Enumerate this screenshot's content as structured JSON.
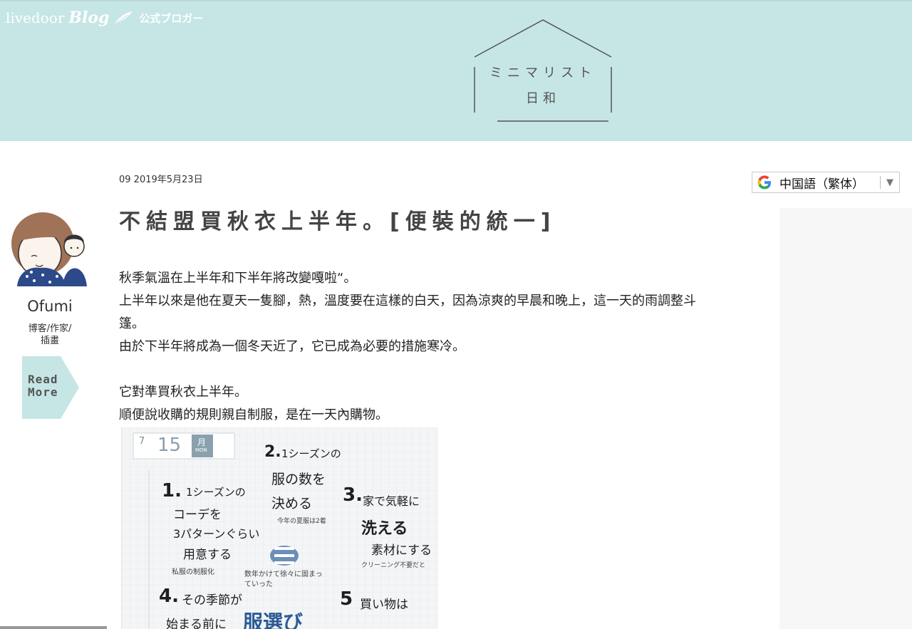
{
  "header": {
    "brand_livedoor": "livedoor",
    "brand_blog": "Blog",
    "brand_official": "公式ブロガー",
    "blog_title": "ミニマリスト",
    "blog_subtitle": "日和",
    "background_color": "#c5e6e4"
  },
  "translate_widget": {
    "language": "中国語（繁体）",
    "icon": "google-g-icon",
    "arrow": "▼"
  },
  "profile": {
    "name": "Ofumi",
    "role_line1": "博客/作家/",
    "role_line2": "插畫",
    "read_more_line1": "Read",
    "read_more_line2": "More",
    "read_more_color": "#c5e6e4"
  },
  "post": {
    "date": "09 2019年5月23日",
    "title": "不結盟買秋衣上半年。[便裝的統一]",
    "paragraphs": [
      "秋季氣溫在上半年和下半年將改變嘎啦“。",
      "上半年以來是他在夏天一隻腳，熱，溫度要在這樣的白天，因為涼爽的早晨和晚上，這一天的雨調整斗",
      "篷。",
      "由於下半年將成為一個冬天近了，它已成為必要的措施寒冷。",
      "",
      "它對準買秋衣上半年。",
      "順便說收購的規則親自制服，是在一天內購物。"
    ]
  },
  "illustration": {
    "date_month": "7",
    "date_day": "15",
    "date_weekday": "月",
    "date_weekday_en": "MON",
    "items": [
      {
        "num": "1.",
        "lines": [
          "1シーズンの",
          "コーデを",
          "3パターンぐらい",
          "用意する"
        ],
        "note": "私服の制服化"
      },
      {
        "num": "2.",
        "lines": [
          "1シーズンの",
          "服の数を",
          "決める"
        ],
        "note": "今年の夏服は2着"
      },
      {
        "num": "3.",
        "lines": [
          "家で気軽に",
          "洗える",
          "素材にする"
        ],
        "note": "クリーニング不要だと"
      },
      {
        "num": "4.",
        "lines": [
          "その季節が",
          "始まる前に"
        ],
        "note": ""
      },
      {
        "num": "5",
        "lines": [
          "買い物は"
        ],
        "note": ""
      }
    ],
    "center_note": "数年かけて徐々に固まっていった",
    "big_text": "服選び"
  }
}
